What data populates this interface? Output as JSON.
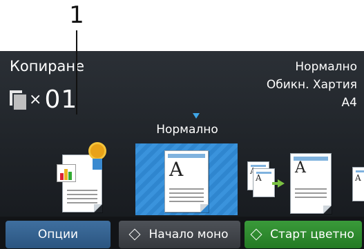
{
  "callout": {
    "number": "1"
  },
  "header": {
    "title": "Копиране",
    "copy_multiplier": "×",
    "copy_count": "01",
    "settings": [
      "Нормално",
      "Обикн. Хартия",
      "A4"
    ]
  },
  "mode": {
    "selected_label": "Нормално"
  },
  "docs": {
    "glyph": "A"
  },
  "buttons": {
    "options": "Опции",
    "mono_start": "Начало моно",
    "color_start": "Старт цветно"
  },
  "colors": {
    "selected_tile": "#2f86cf",
    "options_button": "#3f6f9f",
    "color_button": "#2f8a2f",
    "indicator": "#3fa6e8"
  }
}
